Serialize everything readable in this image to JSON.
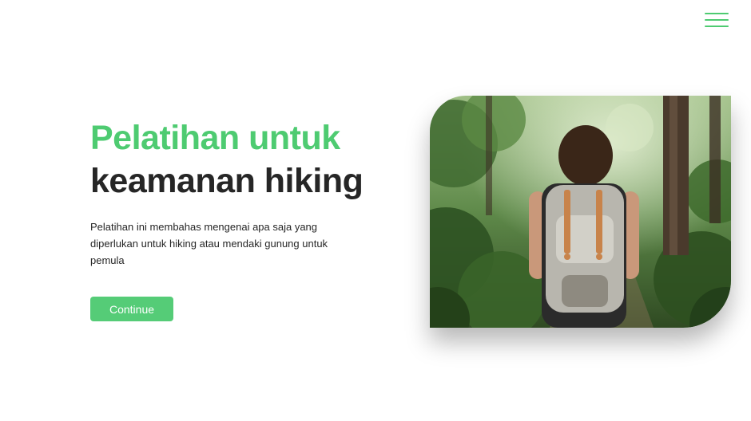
{
  "nav": {
    "menu_icon": "hamburger-menu-icon",
    "accent_color": "#4ecb71"
  },
  "hero": {
    "title_line1": "Pelatihan untuk",
    "title_line2": "keamanan hiking",
    "description": "Pelatihan ini membahas mengenai apa saja yang diperlukan untuk hiking atau mendaki gunung untuk pemula",
    "cta_label": "Continue",
    "image_alt": "hiker-with-backpack-in-forest"
  }
}
